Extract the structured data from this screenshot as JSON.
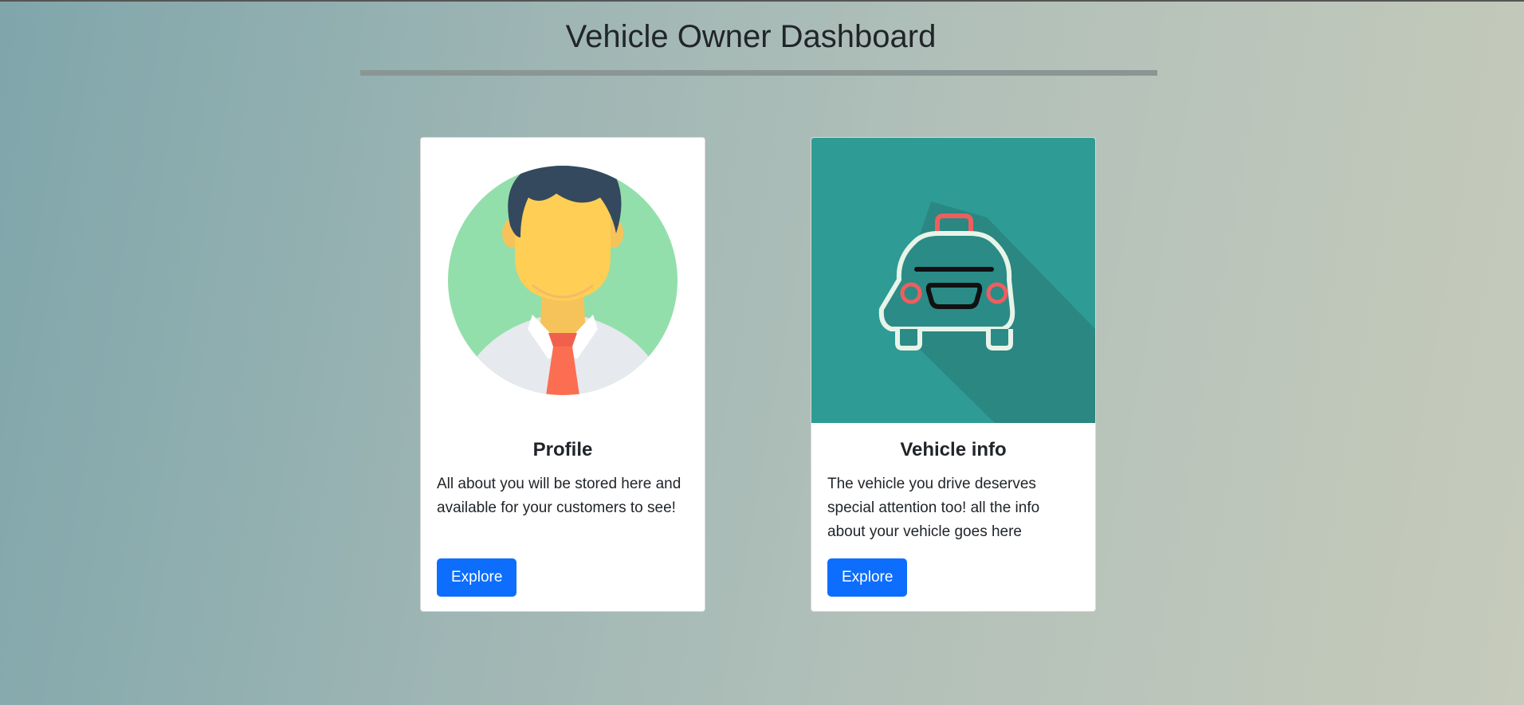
{
  "page": {
    "title": "Vehicle Owner Dashboard"
  },
  "cards": [
    {
      "title": "Profile",
      "text": "All about you will be stored here and available for your customers to see!",
      "button_label": "Explore",
      "icon": "user-avatar-icon"
    },
    {
      "title": "Vehicle info",
      "text": "The vehicle you drive deserves special attention too! all the info about your vehicle goes here",
      "button_label": "Explore",
      "icon": "taxi-car-icon"
    }
  ],
  "colors": {
    "button": "#0d6efd",
    "vehicle_bg": "#2e9b94",
    "avatar_bg": "#93dfab"
  }
}
